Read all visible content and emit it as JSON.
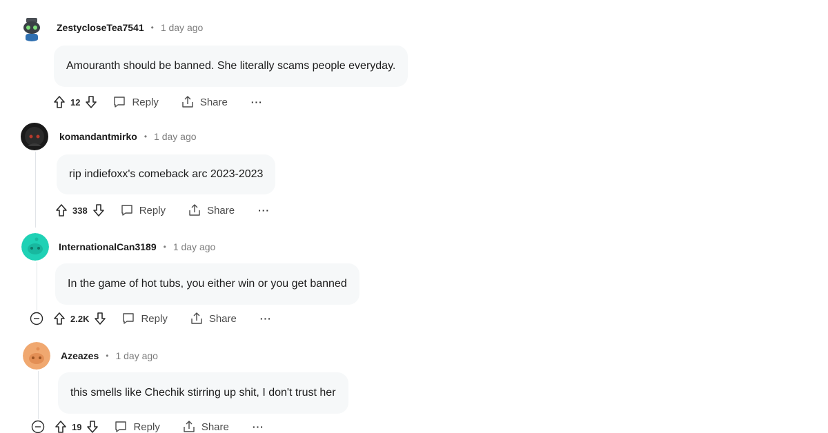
{
  "comments": [
    {
      "username": "ZestycloseTea7541",
      "time": "1 day ago",
      "text": "Amouranth should be banned. She literally scams people everyday.",
      "votes": "12",
      "reply_label": "Reply",
      "share_label": "Share",
      "more_label": "···",
      "avatar_icon": "snoo-avatar-dark"
    },
    {
      "username": "komandantmirko",
      "time": "1 day ago",
      "text": "rip indiefoxx's comeback arc 2023-2023",
      "votes": "338",
      "reply_label": "Reply",
      "share_label": "Share",
      "more_label": "···",
      "avatar_icon": "snoo-avatar-black"
    },
    {
      "username": "InternationalCan3189",
      "time": "1 day ago",
      "text": "In the game of hot tubs, you either win or you get banned",
      "votes": "2.2K",
      "reply_label": "Reply",
      "share_label": "Share",
      "more_label": "···",
      "avatar_icon": "snoo-avatar-teal"
    },
    {
      "username": "Azeazes",
      "time": "1 day ago",
      "text": "this smells like Chechik stirring up shit, I don't trust her",
      "votes": "19",
      "reply_label": "Reply",
      "share_label": "Share",
      "more_label": "···",
      "avatar_icon": "snoo-avatar-orange"
    }
  ],
  "separator": "•",
  "colors": {
    "bubble": "#f6f8f9",
    "meta": "#7c7c7c",
    "teal_avatar": "#1fd1b5",
    "orange_avatar": "#f0a870"
  }
}
